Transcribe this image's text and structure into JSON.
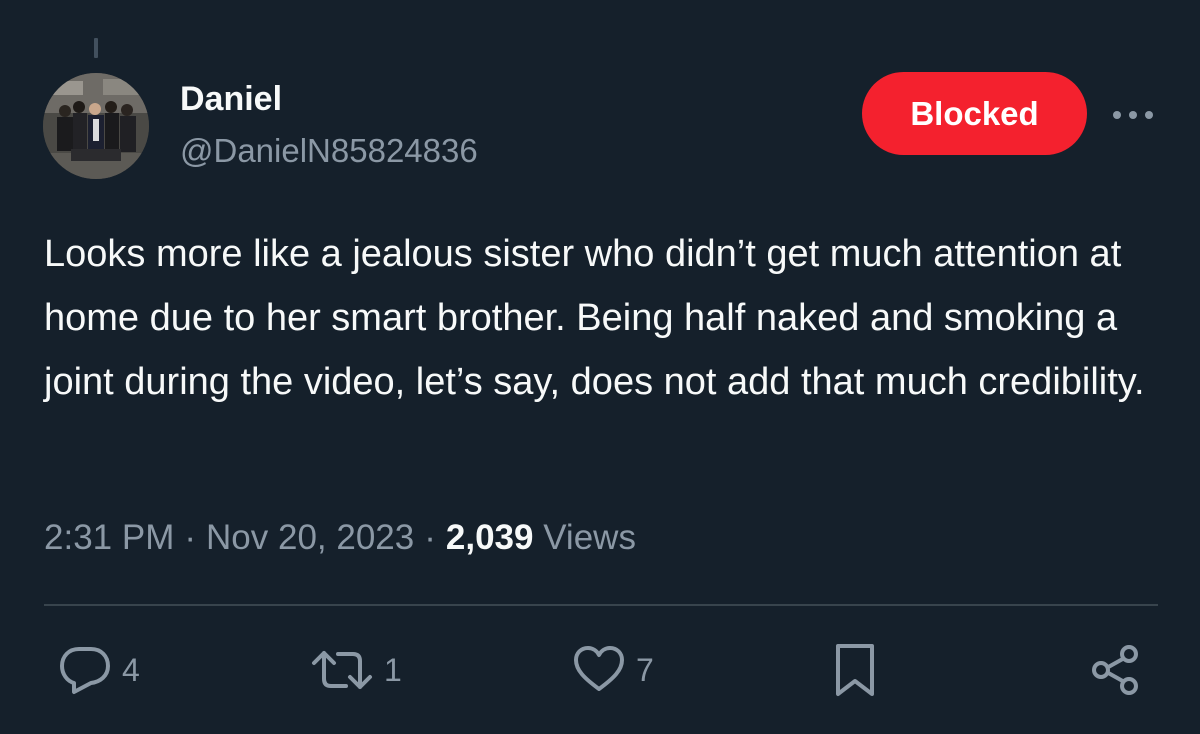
{
  "user": {
    "display_name": "Daniel",
    "handle": "@DanielN85824836"
  },
  "follow_button": {
    "label": "Blocked",
    "color": "#f4212e"
  },
  "more_icon": "more-horizontal-icon",
  "tweet": {
    "text": "Looks more like a jealous sister who didn’t get much attention at home due to her smart brother. Being half naked and smoking a joint during the video, let’s say, does not add that much credibility."
  },
  "meta": {
    "time": "2:31 PM",
    "separator": "·",
    "date": "Nov 20, 2023",
    "views_count": "2,039",
    "views_label": "Views"
  },
  "actions": {
    "replies": {
      "icon": "reply-icon",
      "count": "4"
    },
    "retweets": {
      "icon": "retweet-icon",
      "count": "1"
    },
    "likes": {
      "icon": "heart-icon",
      "count": "7"
    },
    "bookmark": {
      "icon": "bookmark-icon"
    },
    "share": {
      "icon": "share-icon"
    }
  },
  "colors": {
    "background": "#15202b",
    "text_primary": "#f7f9f9",
    "text_secondary": "#8b98a5",
    "divider": "#38444d"
  }
}
